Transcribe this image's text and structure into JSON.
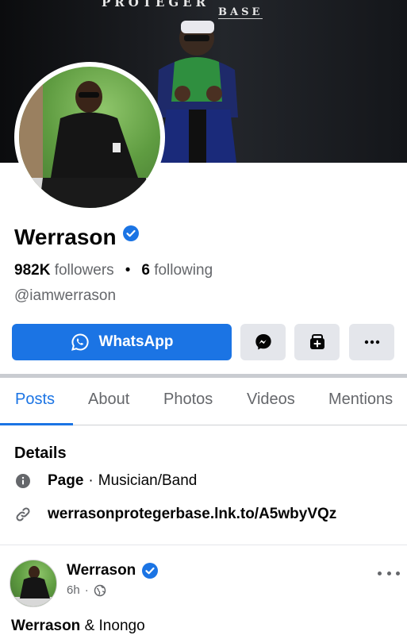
{
  "cover": {
    "title_line_1": "PROTEGER",
    "title_line_2": "BASE"
  },
  "profile": {
    "name": "Werrason",
    "followers_count": "982K",
    "followers_label": "followers",
    "separator": "•",
    "following_count": "6",
    "following_label": "following",
    "handle": "@iamwerrason"
  },
  "actions": {
    "primary_label": "WhatsApp",
    "messenger_icon": "messenger-icon",
    "shop_icon": "shop-icon",
    "more_icon": "more-icon"
  },
  "tabs": [
    {
      "label": "Posts",
      "active": true
    },
    {
      "label": "About",
      "active": false
    },
    {
      "label": "Photos",
      "active": false
    },
    {
      "label": "Videos",
      "active": false
    },
    {
      "label": "Mentions",
      "active": false
    }
  ],
  "details": {
    "title": "Details",
    "page_bold": "Page",
    "page_sep": "·",
    "page_category": "Musician/Band",
    "link": "werrasonprotegerbase.lnk.to/A5wbyVQz"
  },
  "post": {
    "author": "Werrason",
    "time": "6h",
    "meta_sep": "·",
    "text_bold": "Werrason",
    "text_rest": " & Inongo"
  },
  "colors": {
    "accent": "#1b74e4",
    "secondary_text": "#65676b",
    "button_gray": "#e4e6eb"
  }
}
